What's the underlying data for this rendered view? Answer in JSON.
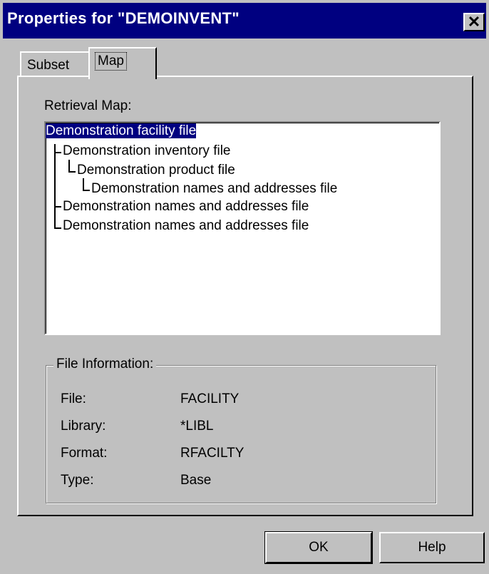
{
  "window": {
    "title": "Properties for \"DEMOINVENT\"",
    "close_label": "✕"
  },
  "tabs": [
    {
      "label": "Subset",
      "active": false
    },
    {
      "label": "Map",
      "active": true
    }
  ],
  "retrieval": {
    "label": "Retrieval Map:",
    "tree": [
      {
        "label": "Demonstration facility file",
        "level": 0,
        "selected": true
      },
      {
        "label": "Demonstration inventory file",
        "level": 1,
        "selected": false
      },
      {
        "label": "Demonstration product file",
        "level": 2,
        "selected": false
      },
      {
        "label": "Demonstration names and addresses file",
        "level": 3,
        "selected": false
      },
      {
        "label": "Demonstration names and addresses file",
        "level": 1,
        "selected": false
      },
      {
        "label": "Demonstration names and addresses file",
        "level": 1,
        "selected": false
      }
    ]
  },
  "file_info": {
    "title": "File Information:",
    "rows": [
      {
        "label": "File:",
        "value": "FACILITY"
      },
      {
        "label": "Library:",
        "value": "*LIBL"
      },
      {
        "label": "Format:",
        "value": "RFACILTY"
      },
      {
        "label": "Type:",
        "value": "Base"
      }
    ]
  },
  "buttons": {
    "ok": "OK",
    "help": "Help"
  }
}
